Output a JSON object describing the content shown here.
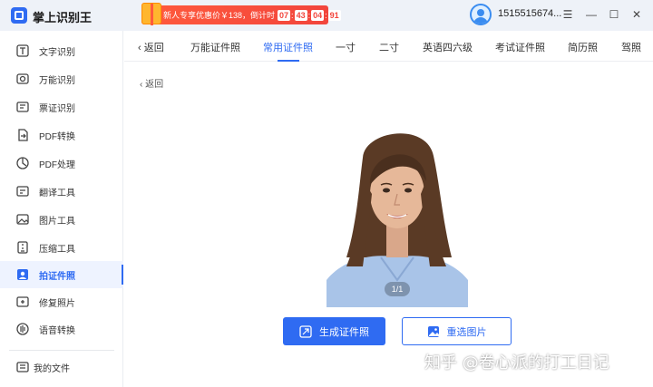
{
  "app": {
    "title": "掌上识别王"
  },
  "promo": {
    "text": "新人专享优惠价￥138，倒计时",
    "countdown": [
      "07",
      "43",
      "04",
      "91"
    ],
    "separator": ":"
  },
  "user": {
    "name": "1515515674..."
  },
  "window_controls": {
    "menu": "☰",
    "minimize": "—",
    "maximize": "☐",
    "close": "✕"
  },
  "sidebar": {
    "items": [
      {
        "label": "文字识别",
        "icon": "text-recognition-icon"
      },
      {
        "label": "万能识别",
        "icon": "universal-recognition-icon"
      },
      {
        "label": "票证识别",
        "icon": "ticket-recognition-icon"
      },
      {
        "label": "PDF转换",
        "icon": "pdf-convert-icon"
      },
      {
        "label": "PDF处理",
        "icon": "pdf-process-icon"
      },
      {
        "label": "翻译工具",
        "icon": "translate-icon"
      },
      {
        "label": "图片工具",
        "icon": "image-tool-icon"
      },
      {
        "label": "压缩工具",
        "icon": "compress-icon"
      },
      {
        "label": "拍证件照",
        "icon": "id-photo-icon",
        "active": true
      },
      {
        "label": "修复照片",
        "icon": "photo-repair-icon"
      },
      {
        "label": "语音转换",
        "icon": "voice-convert-icon"
      }
    ],
    "footer": {
      "label": "我的文件",
      "icon": "my-files-icon"
    }
  },
  "tabs": {
    "back": "返回",
    "items": [
      "万能证件照",
      "常用证件照",
      "一寸",
      "二寸",
      "英语四六级",
      "考试证件照",
      "简历照",
      "驾照"
    ],
    "active": "常用证件照"
  },
  "main": {
    "back": "返回",
    "page_indicator": "1/1",
    "generate_button": "生成证件照",
    "reselect_button": "重选图片"
  },
  "watermark": "知乎 @卷心派的打工日记",
  "colors": {
    "accent": "#2f6bf2",
    "promo": "#f2453c"
  }
}
